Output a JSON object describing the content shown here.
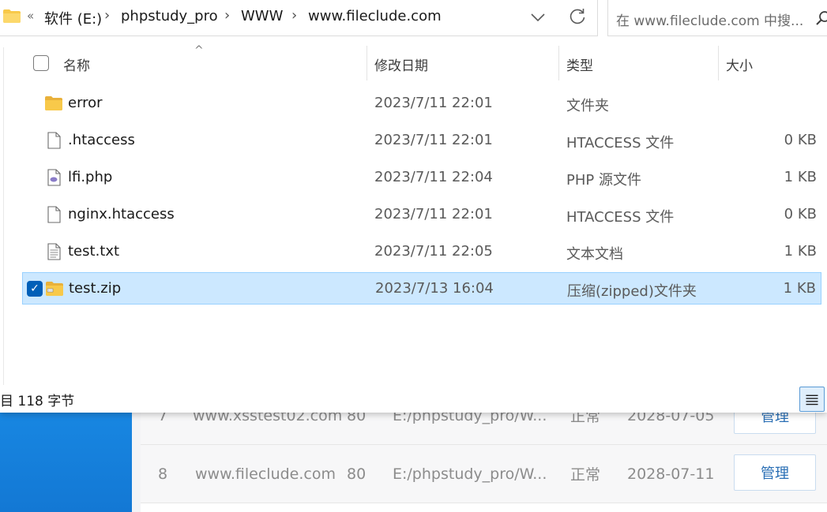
{
  "explorer": {
    "breadcrumb": {
      "overflow": "«",
      "items": [
        "软件 (E:)",
        "phpstudy_pro",
        "WWW",
        "www.fileclude.com"
      ]
    },
    "search": {
      "placeholder": "在 www.fileclude.com 中搜..."
    },
    "columns": {
      "name": "名称",
      "modified": "修改日期",
      "type": "类型",
      "size": "大小"
    },
    "files": [
      {
        "name": "error",
        "modified": "2023/7/11 22:01",
        "type": "文件夹",
        "size": "",
        "icon": "folder-icon",
        "selected": false
      },
      {
        "name": ".htaccess",
        "modified": "2023/7/11 22:01",
        "type": "HTACCESS 文件",
        "size": "0 KB",
        "icon": "file-icon",
        "selected": false
      },
      {
        "name": "lfi.php",
        "modified": "2023/7/11 22:04",
        "type": "PHP 源文件",
        "size": "1 KB",
        "icon": "php-file-icon",
        "selected": false
      },
      {
        "name": "nginx.htaccess",
        "modified": "2023/7/11 22:01",
        "type": "HTACCESS 文件",
        "size": "0 KB",
        "icon": "file-icon",
        "selected": false
      },
      {
        "name": "test.txt",
        "modified": "2023/7/11 22:05",
        "type": "文本文档",
        "size": "1 KB",
        "icon": "text-file-icon",
        "selected": false
      },
      {
        "name": "test.zip",
        "modified": "2023/7/13 16:04",
        "type": "压缩(zipped)文件夹",
        "size": "1 KB",
        "icon": "zip-folder-icon",
        "selected": true
      }
    ],
    "status": "目 118 字节"
  },
  "background_app": {
    "rows": [
      {
        "index": "7",
        "domain": "www.xsstest02.com",
        "port": "80",
        "path": "E:/phpstudy_pro/W...",
        "status": "正常",
        "date": "2028-07-05",
        "action": "管理"
      },
      {
        "index": "8",
        "domain": "www.fileclude.com",
        "port": "80",
        "path": "E:/phpstudy_pro/W...",
        "status": "正常",
        "date": "2028-07-11",
        "action": "管理"
      }
    ]
  },
  "colors": {
    "selection_bg": "#cce8ff",
    "selection_border": "#99d1ff",
    "checkbox_accent": "#005fb8",
    "folder_yellow": "#f8c94a",
    "sidebar_blue": "#1887e2"
  }
}
